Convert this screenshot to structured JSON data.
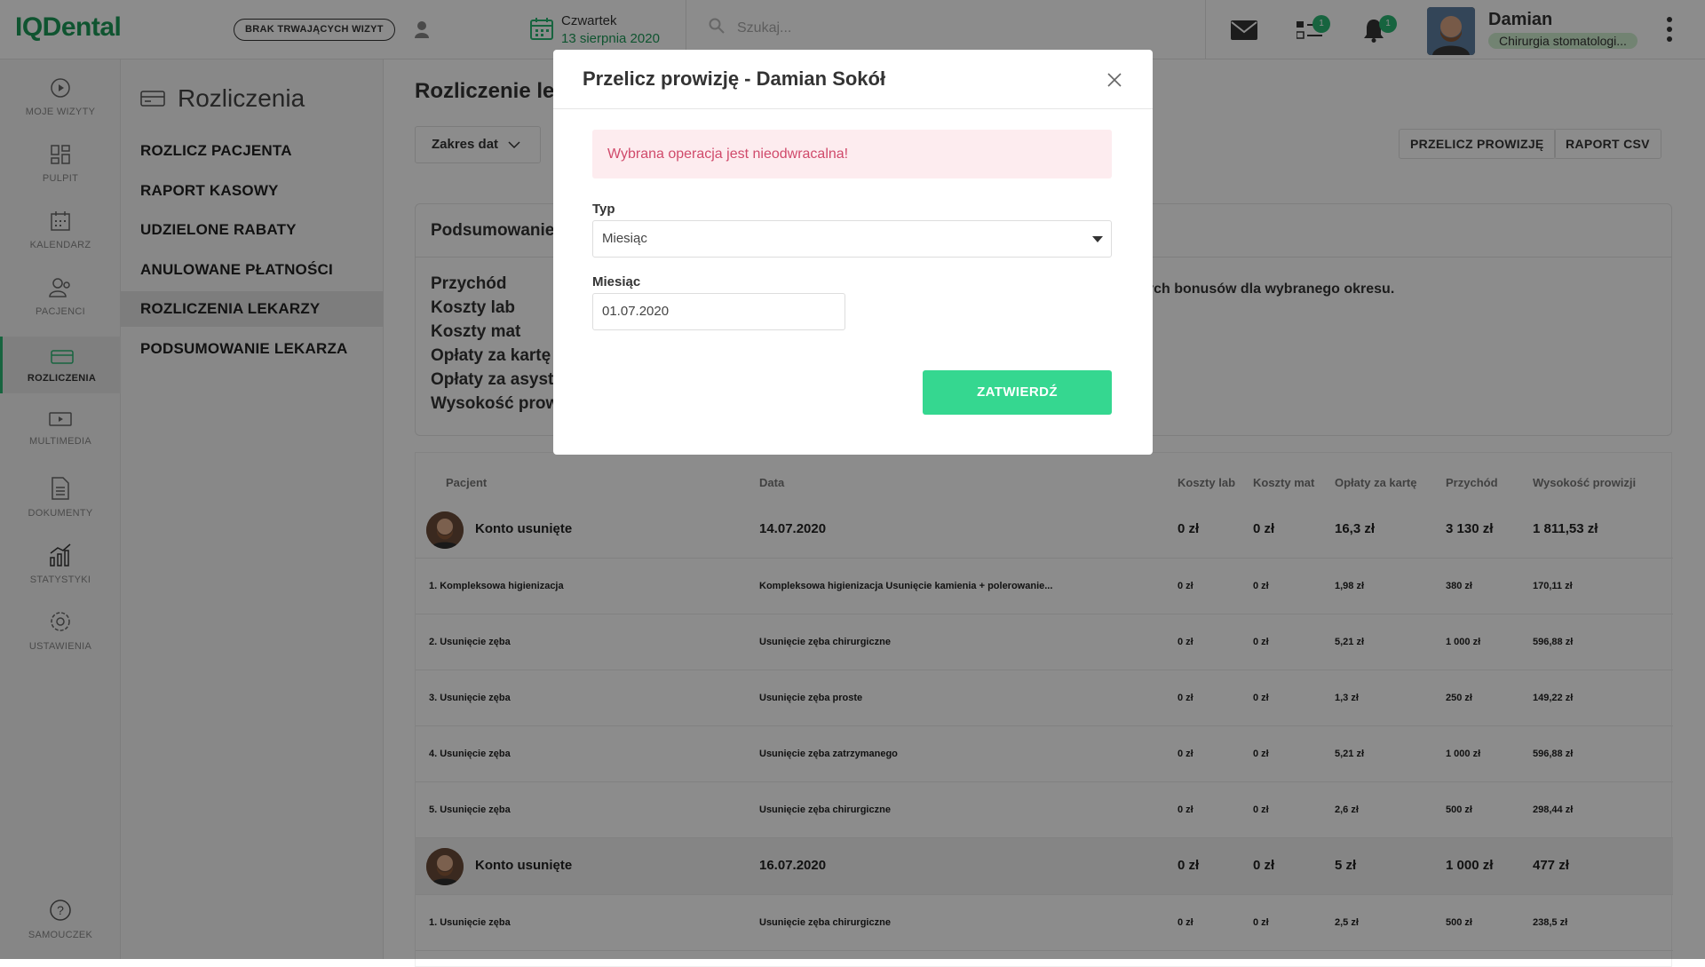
{
  "app": {
    "logo": "IQDental",
    "visit_status": "BRAK TRWAJĄCYCH WIZYT",
    "day": "Czwartek",
    "date": "13 sierpnia 2020",
    "search_placeholder": "Szukaj...",
    "messages_badge": "1",
    "notifications_badge": "1",
    "user_name": "Damian",
    "user_role": "Chirurgia stomatologi..."
  },
  "sidebar": {
    "items": [
      {
        "label": "MOJE WIZYTY",
        "icon": "play-circle-icon"
      },
      {
        "label": "PULPIT",
        "icon": "dashboard-icon"
      },
      {
        "label": "KALENDARZ",
        "icon": "calendar-icon"
      },
      {
        "label": "PACJENCI",
        "icon": "patients-icon"
      },
      {
        "label": "ROZLICZENIA",
        "icon": "billing-icon"
      },
      {
        "label": "MULTIMEDIA",
        "icon": "multimedia-icon"
      },
      {
        "label": "DOKUMENTY",
        "icon": "document-icon"
      },
      {
        "label": "STATYSTYKI",
        "icon": "statistics-icon"
      },
      {
        "label": "USTAWIENIA",
        "icon": "settings-icon"
      },
      {
        "label": "SAMOUCZEK",
        "icon": "help-icon"
      }
    ]
  },
  "subnav": {
    "title": "Rozliczenia",
    "items": [
      {
        "label": "ROZLICZ PACJENTA"
      },
      {
        "label": "RAPORT KASOWY"
      },
      {
        "label": "UDZIELONE RABATY"
      },
      {
        "label": "ANULOWANE PŁATNOŚCI"
      },
      {
        "label": "ROZLICZENIA LEKARZY"
      },
      {
        "label": "PODSUMOWANIE LEKARZA"
      }
    ]
  },
  "content": {
    "title": "Rozliczenie le",
    "range_label": "Zakres dat",
    "btn_recalc": "PRZELICZ PROWIZJĘ",
    "btn_csv": "RAPORT CSV",
    "summary_title": "Podsumowanie",
    "summary_rows": [
      "Przychód",
      "Koszty lab",
      "Koszty mat",
      "Opłaty za kartę",
      "Opłaty za asyst",
      "Wysokość prow"
    ],
    "bonus_note": "wnych bonusów dla wybranego okresu."
  },
  "table": {
    "headers": [
      "Pacjent",
      "Data",
      "Koszty lab",
      "Koszty mat",
      "Opłaty za kartę",
      "Przychód",
      "Wysokość prowizji"
    ],
    "rows": [
      {
        "kind": "main",
        "patient": "Konto usunięte",
        "data": "14.07.2020",
        "lab": "0 zł",
        "mat": "0 zł",
        "karta": "16,3 zł",
        "przychod": "3 130 zł",
        "prowizja": "1 811,53 zł"
      },
      {
        "kind": "sub",
        "patient": "1. Kompleksowa higienizacja",
        "data": "Kompleksowa higienizacja Usunięcie kamienia + polerowanie...",
        "lab": "0 zł",
        "mat": "0 zł",
        "karta": "1,98 zł",
        "przychod": "380 zł",
        "prowizja": "170,11 zł"
      },
      {
        "kind": "sub",
        "patient": "2. Usunięcie zęba",
        "data": "Usunięcie zęba chirurgiczne",
        "lab": "0 zł",
        "mat": "0 zł",
        "karta": "5,21 zł",
        "przychod": "1 000 zł",
        "prowizja": "596,88 zł"
      },
      {
        "kind": "sub",
        "patient": "3. Usunięcie zęba",
        "data": "Usunięcie zęba proste",
        "lab": "0 zł",
        "mat": "0 zł",
        "karta": "1,3 zł",
        "przychod": "250 zł",
        "prowizja": "149,22 zł"
      },
      {
        "kind": "sub",
        "patient": "4. Usunięcie zęba",
        "data": "Usunięcie zęba zatrzymanego",
        "lab": "0 zł",
        "mat": "0 zł",
        "karta": "5,21 zł",
        "przychod": "1 000 zł",
        "prowizja": "596,88 zł"
      },
      {
        "kind": "sub",
        "patient": "5. Usunięcie zęba",
        "data": "Usunięcie zęba chirurgiczne",
        "lab": "0 zł",
        "mat": "0 zł",
        "karta": "2,6 zł",
        "przychod": "500 zł",
        "prowizja": "298,44 zł"
      },
      {
        "kind": "main",
        "patient": "Konto usunięte",
        "data": "16.07.2020",
        "lab": "0 zł",
        "mat": "0 zł",
        "karta": "5 zł",
        "przychod": "1 000 zł",
        "prowizja": "477 zł"
      },
      {
        "kind": "sub",
        "patient": "1. Usunięcie zęba",
        "data": "Usunięcie zęba chirurgiczne",
        "lab": "0 zł",
        "mat": "0 zł",
        "karta": "2,5 zł",
        "przychod": "500 zł",
        "prowizja": "238,5 zł"
      }
    ]
  },
  "modal": {
    "title": "Przelicz prowizję - Damian Sokół",
    "alert": "Wybrana operacja jest nieodwracalna!",
    "type_label": "Typ",
    "type_value": "Miesiąc",
    "month_label": "Miesiąc",
    "month_value": "01.07.2020",
    "confirm_label": "ZATWIERDŹ"
  },
  "colors": {
    "brand": "#1d9a58",
    "accent": "#35d790",
    "alert_text": "#d04a6b"
  }
}
